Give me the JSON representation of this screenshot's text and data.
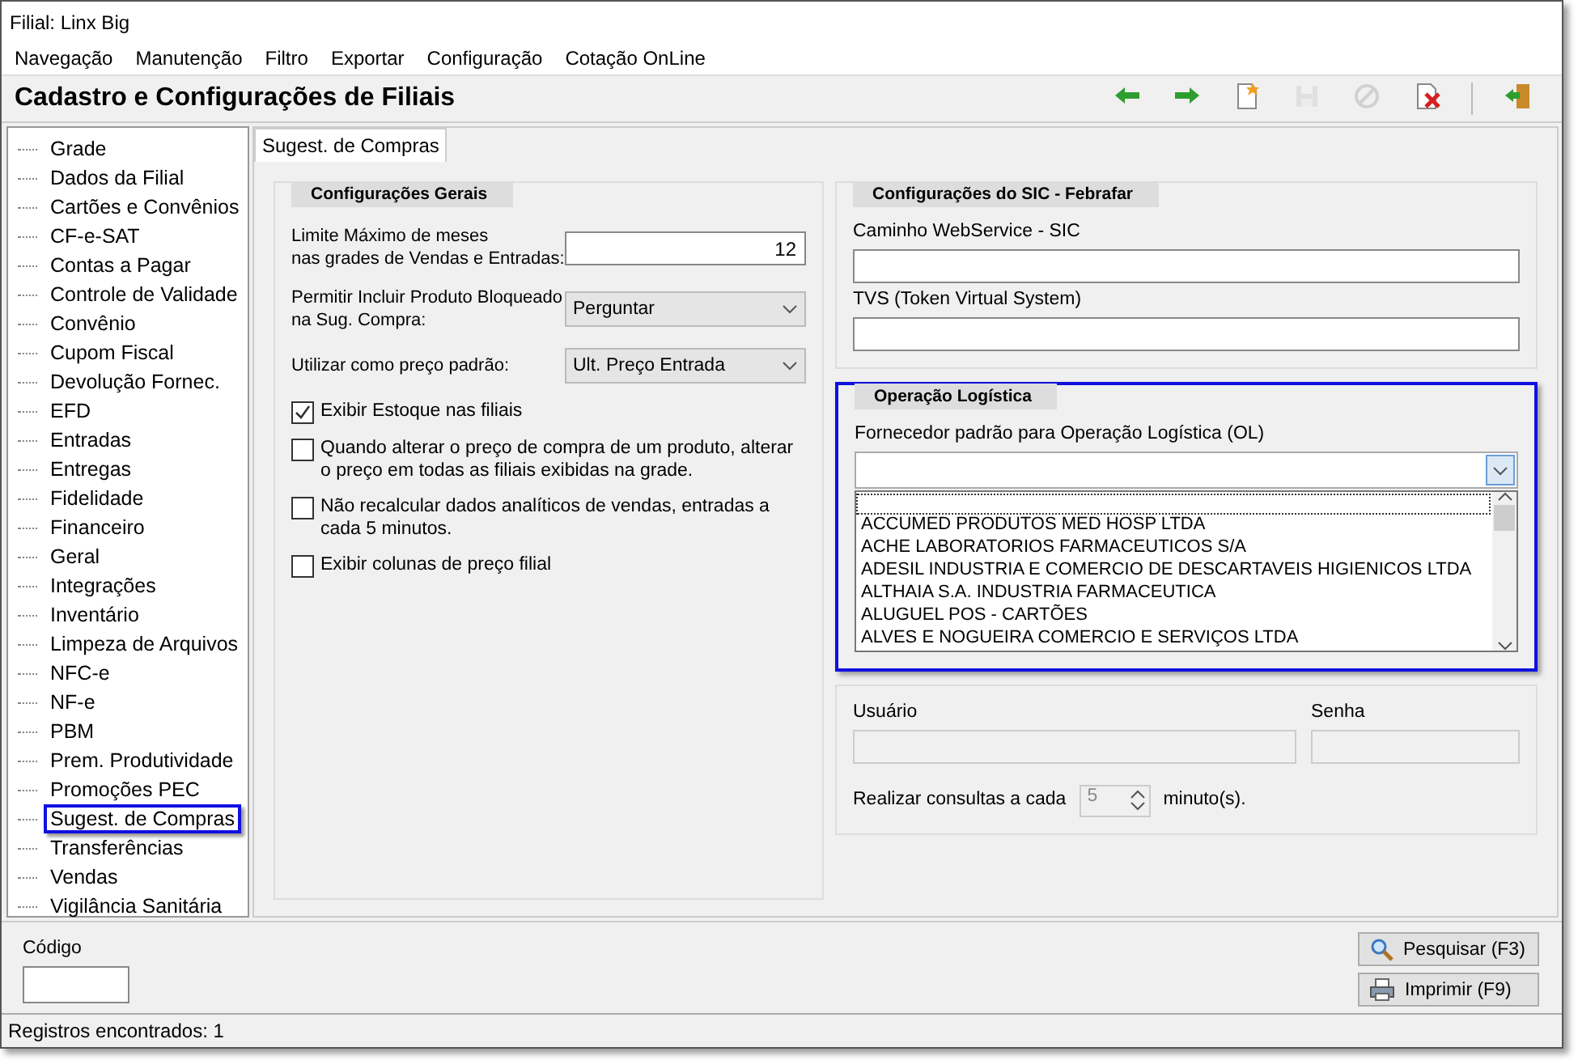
{
  "window": {
    "title": "Filial: Linx Big"
  },
  "menu": [
    "Navegação",
    "Manutenção",
    "Filtro",
    "Exportar",
    "Configuração",
    "Cotação OnLine"
  ],
  "header": {
    "title": "Cadastro e Configurações de Filiais"
  },
  "toolbar": [
    {
      "kind": "back",
      "disabled": false
    },
    {
      "kind": "forward",
      "disabled": false
    },
    {
      "kind": "new",
      "disabled": false
    },
    {
      "kind": "save",
      "disabled": true
    },
    {
      "kind": "cancel",
      "disabled": true
    },
    {
      "kind": "delete",
      "disabled": false
    },
    {
      "kind": "exit",
      "disabled": false
    }
  ],
  "sidebar": {
    "items": [
      {
        "label": "Grade",
        "selected": false
      },
      {
        "label": "Dados da Filial",
        "selected": false
      },
      {
        "label": "Cartões e Convênios",
        "selected": false
      },
      {
        "label": "CF-e-SAT",
        "selected": false
      },
      {
        "label": "Contas a Pagar",
        "selected": false
      },
      {
        "label": "Controle de Validade",
        "selected": false
      },
      {
        "label": "Convênio",
        "selected": false
      },
      {
        "label": "Cupom Fiscal",
        "selected": false
      },
      {
        "label": "Devolução Fornec.",
        "selected": false
      },
      {
        "label": "EFD",
        "selected": false
      },
      {
        "label": "Entradas",
        "selected": false
      },
      {
        "label": "Entregas",
        "selected": false
      },
      {
        "label": "Fidelidade",
        "selected": false
      },
      {
        "label": "Financeiro",
        "selected": false
      },
      {
        "label": "Geral",
        "selected": false
      },
      {
        "label": "Integrações",
        "selected": false
      },
      {
        "label": "Inventário",
        "selected": false
      },
      {
        "label": "Limpeza de Arquivos",
        "selected": false
      },
      {
        "label": "NFC-e",
        "selected": false
      },
      {
        "label": "NF-e",
        "selected": false
      },
      {
        "label": "PBM",
        "selected": false
      },
      {
        "label": "Prem. Produtividade",
        "selected": false
      },
      {
        "label": "Promoções PEC",
        "selected": false
      },
      {
        "label": "Sugest. de Compras",
        "selected": true
      },
      {
        "label": "Transferências",
        "selected": false
      },
      {
        "label": "Vendas",
        "selected": false
      },
      {
        "label": "Vigilância Sanitária",
        "selected": false
      }
    ]
  },
  "tabs": [
    {
      "label": "Sugest. de Compras",
      "selected": true
    }
  ],
  "general": {
    "title": "Configurações Gerais",
    "limit": {
      "label": "Limite Máximo de meses\nnas grades de Vendas e Entradas:",
      "value": "12"
    },
    "blocked": {
      "label": "Permitir Incluir Produto Bloqueado\nna Sug. Compra:",
      "value": "Perguntar"
    },
    "price": {
      "label": "Utilizar como preço padrão:",
      "value": "Ult. Preço Entrada"
    },
    "checks": [
      {
        "label": "Exibir Estoque nas filiais",
        "checked": true
      },
      {
        "label": "Quando alterar o preço de compra de um produto, alterar o preço em todas as filiais exibidas na grade.",
        "checked": false
      },
      {
        "label": "Não recalcular dados analíticos de vendas, entradas a cada 5 minutos.",
        "checked": false
      },
      {
        "label": "Exibir colunas de preço filial",
        "checked": false
      }
    ]
  },
  "sic": {
    "title": "Configurações do SIC - Febrafar",
    "fields": [
      {
        "label": "Caminho WebService - SIC"
      },
      {
        "label": "TVS (Token Virtual System)"
      }
    ]
  },
  "logistics": {
    "title": "Operação Logística",
    "highlighted": true,
    "label": "Fornecedor padrão para Operação Logística (OL)",
    "expanded": true,
    "options": [
      "ACCUMED PRODUTOS MED HOSP LTDA",
      "ACHE LABORATORIOS FARMACEUTICOS S/A",
      "ADESIL INDUSTRIA E COMERCIO DE DESCARTAVEIS HIGIENICOS LTDA",
      "ALTHAIA S.A. INDUSTRIA FARMACEUTICA",
      "ALUGUEL POS - CARTÕES",
      "ALVES E NOGUEIRA COMERCIO E SERVIÇOS LTDA"
    ]
  },
  "credentials": {
    "user": {
      "label": "Usuário",
      "disabled": true
    },
    "password": {
      "label": "Senha",
      "disabled": true
    },
    "interval": {
      "label": "Realizar consultas a cada",
      "value": "5",
      "unit": "minuto(s).",
      "disabled": true
    }
  },
  "footer": {
    "code_label": "Código",
    "buttons": [
      {
        "kind": "search",
        "label": "Pesquisar (F3)"
      },
      {
        "kind": "print",
        "label": "Imprimir (F9)"
      }
    ]
  },
  "status_bar": "Registros encontrados: 1"
}
